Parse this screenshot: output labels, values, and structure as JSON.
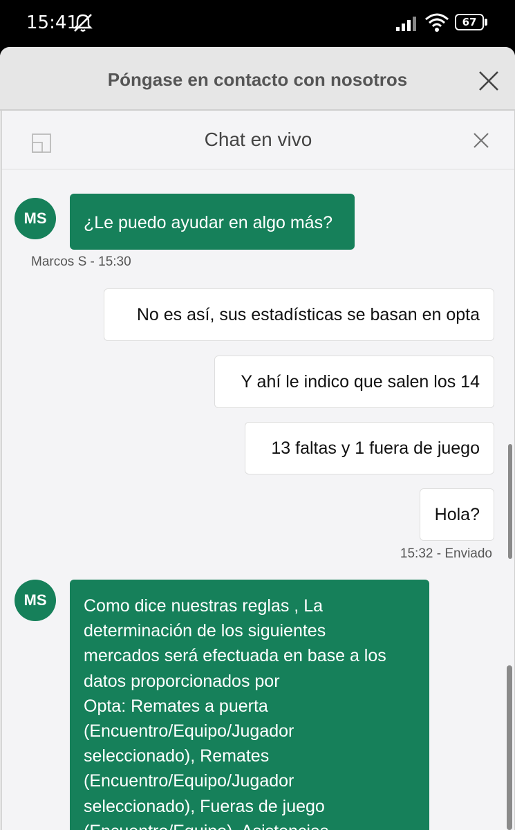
{
  "status_bar": {
    "time": "15:41",
    "battery": "67",
    "icons": [
      "mute-icon",
      "signal-icon",
      "wifi-icon",
      "battery-icon"
    ]
  },
  "sheet": {
    "title": "Póngase en contacto con nosotros"
  },
  "chat": {
    "title": "Chat en vivo",
    "accent_color": "#16805a",
    "messages": [
      {
        "from": "agent",
        "avatar": "MS",
        "text": "¿Le puedo ayudar en algo más?"
      },
      {
        "meta": "Marcos S - 15:30"
      },
      {
        "from": "user",
        "text": "No es así, sus estadísticas se basan en opta"
      },
      {
        "from": "user",
        "text": "Y ahí le indico que salen los 14"
      },
      {
        "from": "user",
        "text": "13 faltas y 1 fuera de juego"
      },
      {
        "from": "user",
        "text": "Hola?"
      },
      {
        "meta": "15:32 - Enviado"
      },
      {
        "from": "agent",
        "avatar": "MS",
        "text": "Como dice nuestras reglas , La\ndeterminación de los siguientes\nmercados será efectuada en base a los\ndatos proporcionados por\nOpta: Remates a puerta\n(Encuentro/Equipo/Jugador\nseleccionado), Remates\n(Encuentro/Equipo/Jugador\nseleccionado), Fueras de juego\n(Encuentro/Equipo), Asistencias\n(Jugador seleccionado), Entrada\n(Equipo/Jugador seleccionado) y Pases"
      }
    ]
  }
}
